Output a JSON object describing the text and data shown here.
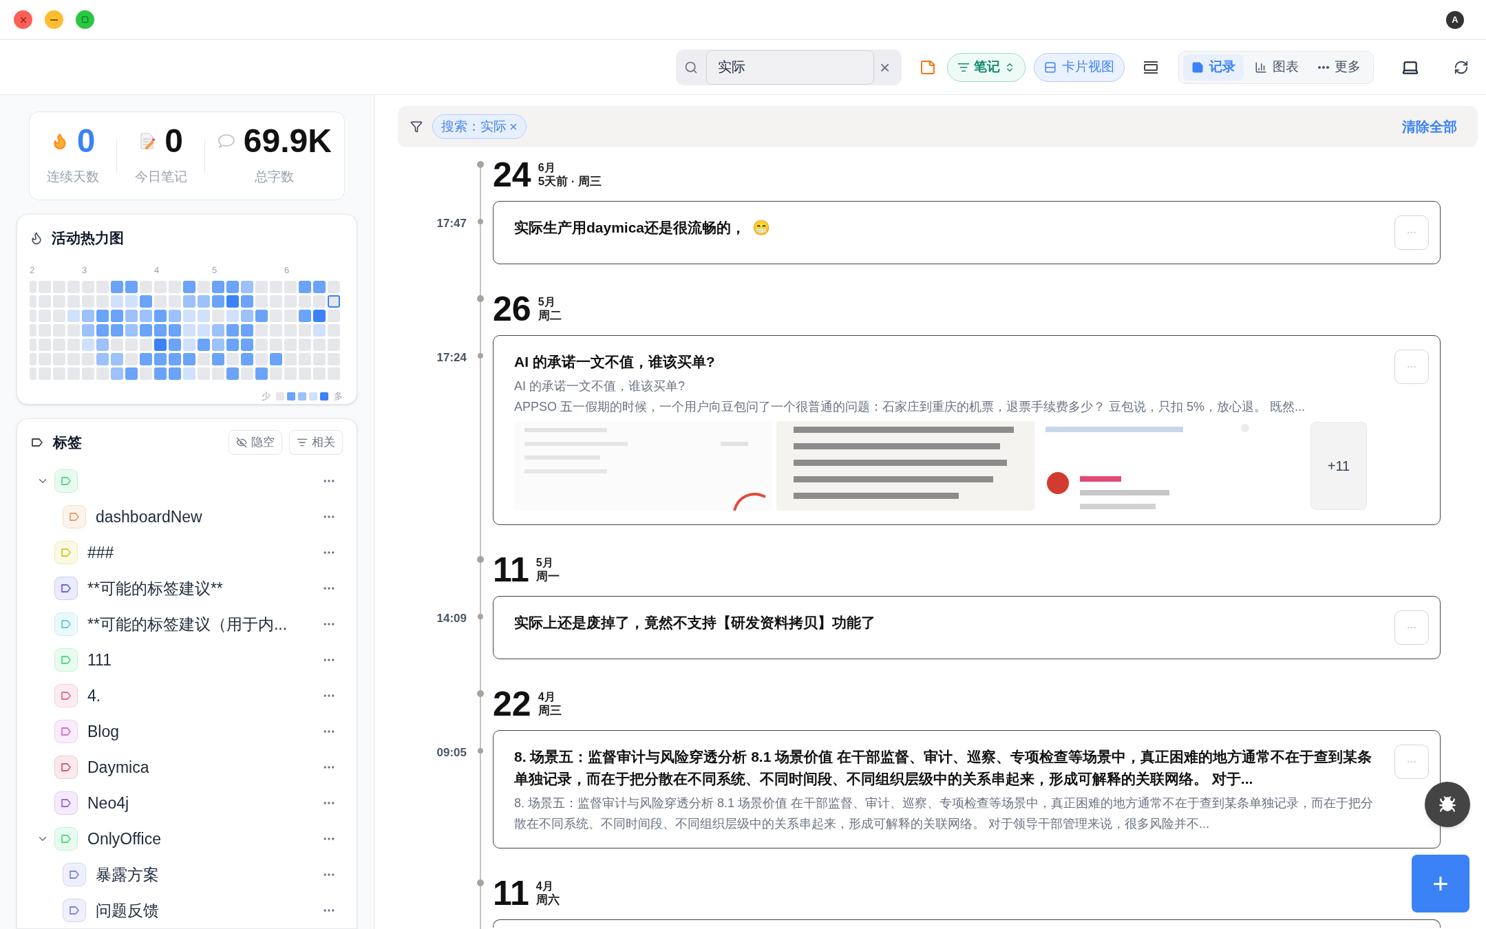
{
  "titlebar": {
    "badge": "A"
  },
  "toolbar": {
    "search": {
      "value": "实际"
    },
    "clear": "×",
    "notes_filter": {
      "label": "笔记"
    },
    "card_view": {
      "label": "卡片视图",
      "selected": true
    },
    "views": [
      {
        "label": "记录",
        "kind": "record",
        "selected": true
      },
      {
        "label": "图表",
        "kind": "chart",
        "selected": false
      },
      {
        "label": "更多",
        "kind": "more",
        "selected": false
      }
    ]
  },
  "stats": [
    {
      "value": "0",
      "label": "连续天数",
      "kind": "streak"
    },
    {
      "value": "0",
      "label": "今日笔记",
      "kind": "today"
    },
    {
      "value": "69.9K",
      "label": "总字数",
      "kind": "words"
    }
  ],
  "heatmap": {
    "title": "活动热力图",
    "columns": [
      {
        "month": "2",
        "cells": [
          {
            "color": "#e5e7eb"
          },
          {
            "color": "#e5e7eb"
          },
          {
            "color": "#e5e7eb"
          },
          {
            "color": "#e5e7eb"
          },
          {
            "color": "#e5e7eb"
          },
          {
            "color": "#e5e7eb"
          },
          {
            "color": "#e5e7eb"
          }
        ]
      },
      {
        "cells": [
          {
            "color": "#e5e7eb"
          },
          {
            "color": "#e5e7eb"
          },
          {
            "color": "#e5e7eb"
          },
          {
            "color": "#e5e7eb"
          },
          {
            "color": "#e5e7eb"
          },
          {
            "color": "#e5e7eb"
          },
          {
            "color": "#e5e7eb"
          }
        ]
      },
      {
        "cells": [
          {
            "color": "#e5e7eb"
          },
          {
            "color": "#e5e7eb"
          },
          {
            "color": "#e5e7eb"
          },
          {
            "color": "#e5e7eb"
          },
          {
            "color": "#e5e7eb"
          },
          {
            "color": "#e5e7eb"
          },
          {
            "color": "#e5e7eb"
          }
        ]
      },
      {
        "cells": [
          {
            "color": "#e5e7eb"
          },
          {
            "color": "#e5e7eb"
          },
          {
            "color": "#d0e1fd"
          },
          {
            "color": "#e5e7eb"
          },
          {
            "color": "#e5e7eb"
          },
          {
            "color": "#e5e7eb"
          },
          {
            "color": "#e5e7eb"
          }
        ]
      },
      {
        "month": "3",
        "cells": [
          {
            "color": "#e5e7eb"
          },
          {
            "color": "#e5e7eb"
          },
          {
            "color": "#9dc1fa"
          },
          {
            "color": "#9dc1fa"
          },
          {
            "color": "#d0e1fd"
          },
          {
            "color": "#e5e7eb"
          },
          {
            "color": "#e5e7eb"
          }
        ]
      },
      {
        "cells": [
          {
            "color": "#e5e7eb"
          },
          {
            "color": "#e5e7eb"
          },
          {
            "color": "#6aa3f8"
          },
          {
            "color": "#6aa3f8"
          },
          {
            "color": "#9dc1fa"
          },
          {
            "color": "#9dc1fa"
          },
          {
            "color": "#e5e7eb"
          }
        ]
      },
      {
        "cells": [
          {
            "color": "#6aa3f8"
          },
          {
            "color": "#d0e1fd"
          },
          {
            "color": "#6aa3f8"
          },
          {
            "color": "#6aa3f8"
          },
          {
            "color": "#e5e7eb"
          },
          {
            "color": "#9dc1fa"
          },
          {
            "color": "#9dc1fa"
          }
        ]
      },
      {
        "cells": [
          {
            "color": "#6aa3f8"
          },
          {
            "color": "#d0e1fd"
          },
          {
            "color": "#9dc1fa"
          },
          {
            "color": "#9dc1fa"
          },
          {
            "color": "#e5e7eb"
          },
          {
            "color": "#e5e7eb"
          },
          {
            "color": "#6aa3f8"
          }
        ]
      },
      {
        "cells": [
          {
            "color": "#e5e7eb"
          },
          {
            "color": "#6aa3f8"
          },
          {
            "color": "#9dc1fa"
          },
          {
            "color": "#6aa3f8"
          },
          {
            "color": "#e5e7eb"
          },
          {
            "color": "#6aa3f8"
          },
          {
            "color": "#e5e7eb"
          }
        ]
      },
      {
        "month": "4",
        "cells": [
          {
            "color": "#e5e7eb"
          },
          {
            "color": "#e5e7eb"
          },
          {
            "color": "#6aa3f8"
          },
          {
            "color": "#6aa3f8"
          },
          {
            "color": "#3b82f6"
          },
          {
            "color": "#6aa3f8"
          },
          {
            "color": "#6aa3f8"
          }
        ]
      },
      {
        "cells": [
          {
            "color": "#e5e7eb"
          },
          {
            "color": "#e5e7eb"
          },
          {
            "color": "#9dc1fa"
          },
          {
            "color": "#6aa3f8"
          },
          {
            "color": "#6aa3f8"
          },
          {
            "color": "#6aa3f8"
          },
          {
            "color": "#6aa3f8"
          }
        ]
      },
      {
        "cells": [
          {
            "color": "#6aa3f8"
          },
          {
            "color": "#9dc1fa"
          },
          {
            "color": "#d0e1fd"
          },
          {
            "color": "#d0e1fd"
          },
          {
            "color": "#d0e1fd"
          },
          {
            "color": "#6aa3f8"
          },
          {
            "color": "#d0e1fd"
          }
        ]
      },
      {
        "cells": [
          {
            "color": "#e5e7eb"
          },
          {
            "color": "#9dc1fa"
          },
          {
            "color": "#d0e1fd"
          },
          {
            "color": "#d0e1fd"
          },
          {
            "color": "#6aa3f8"
          },
          {
            "color": "#e5e7eb"
          },
          {
            "color": "#e5e7eb"
          }
        ]
      },
      {
        "month": "5",
        "cells": [
          {
            "color": "#6aa3f8"
          },
          {
            "color": "#6aa3f8"
          },
          {
            "color": "#e5e7eb"
          },
          {
            "color": "#9dc1fa"
          },
          {
            "color": "#9dc1fa"
          },
          {
            "color": "#6aa3f8"
          },
          {
            "color": "#e5e7eb"
          }
        ]
      },
      {
        "cells": [
          {
            "color": "#6aa3f8"
          },
          {
            "color": "#3b82f6"
          },
          {
            "color": "#d0e1fd"
          },
          {
            "color": "#6aa3f8"
          },
          {
            "color": "#6aa3f8"
          },
          {
            "color": "#e5e7eb"
          },
          {
            "color": "#6aa3f8"
          }
        ]
      },
      {
        "cells": [
          {
            "color": "#9dc1fa"
          },
          {
            "color": "#6aa3f8"
          },
          {
            "color": "#9dc1fa"
          },
          {
            "color": "#6aa3f8"
          },
          {
            "color": "#6aa3f8"
          },
          {
            "color": "#6aa3f8"
          },
          {
            "color": "#e5e7eb"
          }
        ]
      },
      {
        "cells": [
          {
            "color": "#e5e7eb"
          },
          {
            "color": "#e5e7eb"
          },
          {
            "color": "#6aa3f8"
          },
          {
            "color": "#e5e7eb"
          },
          {
            "color": "#e5e7eb"
          },
          {
            "color": "#e5e7eb"
          },
          {
            "color": "#6aa3f8"
          }
        ]
      },
      {
        "cells": [
          {
            "color": "#e5e7eb"
          },
          {
            "color": "#e5e7eb"
          },
          {
            "color": "#e5e7eb"
          },
          {
            "color": "#e5e7eb"
          },
          {
            "color": "#e5e7eb"
          },
          {
            "color": "#6aa3f8"
          },
          {
            "color": "#e5e7eb"
          }
        ]
      },
      {
        "month": "6",
        "cells": [
          {
            "color": "#e5e7eb"
          },
          {
            "color": "#e5e7eb"
          },
          {
            "color": "#e5e7eb"
          },
          {
            "color": "#e5e7eb"
          },
          {
            "color": "#e5e7eb"
          },
          {
            "color": "#e5e7eb"
          },
          {
            "color": "#e5e7eb"
          }
        ]
      },
      {
        "cells": [
          {
            "color": "#6aa3f8"
          },
          {
            "color": "#e5e7eb"
          },
          {
            "color": "#6aa3f8"
          },
          {
            "color": "#e5e7eb"
          },
          {
            "color": "#e5e7eb"
          },
          {
            "color": "#e5e7eb"
          },
          {
            "color": "#e5e7eb"
          }
        ]
      },
      {
        "cells": [
          {
            "color": "#6aa3f8"
          },
          {
            "color": "#e5e7eb"
          },
          {
            "color": "#3b82f6"
          },
          {
            "color": "#d0e1fd"
          },
          {
            "color": "#e5e7eb"
          },
          {
            "color": "#e5e7eb"
          },
          {
            "color": "#e5e7eb"
          }
        ]
      },
      {
        "cells": [
          {
            "color": "#e5e7eb"
          },
          {
            "color": "#e5e7eb",
            "today": true
          },
          {
            "color": "#e5e7eb"
          },
          {
            "color": "#e5e7eb"
          },
          {
            "color": "#e5e7eb"
          },
          {
            "color": "#e5e7eb"
          },
          {
            "color": "#e5e7eb"
          }
        ]
      }
    ],
    "legend": {
      "low": "少",
      "high": "多",
      "swatches": [
        {
          "color": "#e5e7eb"
        },
        {
          "color": "#6aa3f8"
        },
        {
          "color": "#9dc1fa"
        },
        {
          "color": "#d0e1fd"
        },
        {
          "color": "#3b82f6"
        }
      ]
    }
  },
  "tags": {
    "title": "标签",
    "buttons": [
      {
        "label": "隐空",
        "kind": "hide"
      },
      {
        "label": "相关",
        "kind": "filter"
      }
    ],
    "items": [
      {
        "color": "#4ade80",
        "expanded": true,
        "children": [
          {
            "name": "dashboardNew",
            "color": "#e8a062"
          }
        ]
      },
      {
        "name": "###",
        "color": "#cfcf2a"
      },
      {
        "name": "**可能的标签建议**",
        "color": "#6366f1"
      },
      {
        "name": "**可能的标签建议（用于内...",
        "color": "#5ccfd9"
      },
      {
        "name": "111",
        "color": "#4ade80"
      },
      {
        "name": "4.",
        "color": "#ec6a8c"
      },
      {
        "name": "Blog",
        "color": "#d96ad9"
      },
      {
        "name": "Daymica",
        "color": "#e0556e"
      },
      {
        "name": "Neo4j",
        "color": "#a162e8"
      },
      {
        "name": "OnlyOffice",
        "color": "#4ade80",
        "expanded": true,
        "children": [
          {
            "name": "暴露方案",
            "color": "#7b86e8"
          },
          {
            "name": "问题反馈",
            "color": "#7b86e8"
          }
        ]
      }
    ]
  },
  "filter_bar": {
    "chip": "搜索：实际",
    "chip_close": "×",
    "clear_all": "清除全部"
  },
  "timeline": [
    {
      "day": "24",
      "month": "6月",
      "sub": "5天前 · 周三",
      "entries": [
        {
          "time": "17:47",
          "title": "实际生产用daymica还是很流畅的，",
          "emoji": "😁"
        }
      ]
    },
    {
      "day": "26",
      "month": "5月",
      "sub": "周二",
      "entries": [
        {
          "time": "17:24",
          "title": "AI 的承诺一文不值，谁该买单?",
          "lines": [
            "AI 的承诺一文不值，谁该买单?",
            "APPSO 五一假期的时候，一个用户向豆包问了一个很普通的问题：石家庄到重庆的机票，退票手续费多少？ 豆包说，只扣 5%，放心退。 既然..."
          ],
          "images": [
            {
              "kind": "picture"
            },
            {
              "kind": "picture"
            },
            {
              "kind": "picture"
            }
          ],
          "more_images": "+11"
        }
      ]
    },
    {
      "day": "11",
      "month": "5月",
      "sub": "周一",
      "entries": [
        {
          "time": "14:09",
          "title": "实际上还是废掉了，竟然不支持【研发资料拷贝】功能了"
        }
      ]
    },
    {
      "day": "22",
      "month": "4月",
      "sub": "周三",
      "entries": [
        {
          "time": "09:05",
          "title": "8. 场景五：监督审计与风险穿透分析 8.1 场景价值 在干部监督、审计、巡察、专项检查等场景中，真正困难的地方通常不在于查到某条单独记录，而在于把分散在不同系统、不同时间段、不同组织层级中的关系串起来，形成可解释的关联网络。 对于...",
          "lines": [
            "8. 场景五：监督审计与风险穿透分析 8.1 场景价值 在干部监督、审计、巡察、专项检查等场景中，真正困难的地方通常不在于查到某条单独记录，而在于把分散在不同系统、不同时间段、不同组织层级中的关系串起来，形成可解释的关联网络。 对于领导干部管理来说，很多风险并不..."
          ]
        }
      ]
    },
    {
      "day": "11",
      "month": "4月",
      "sub": "周六",
      "entries": [
        {
          "kind": "cut"
        }
      ]
    }
  ],
  "fab": {
    "add": "+"
  }
}
